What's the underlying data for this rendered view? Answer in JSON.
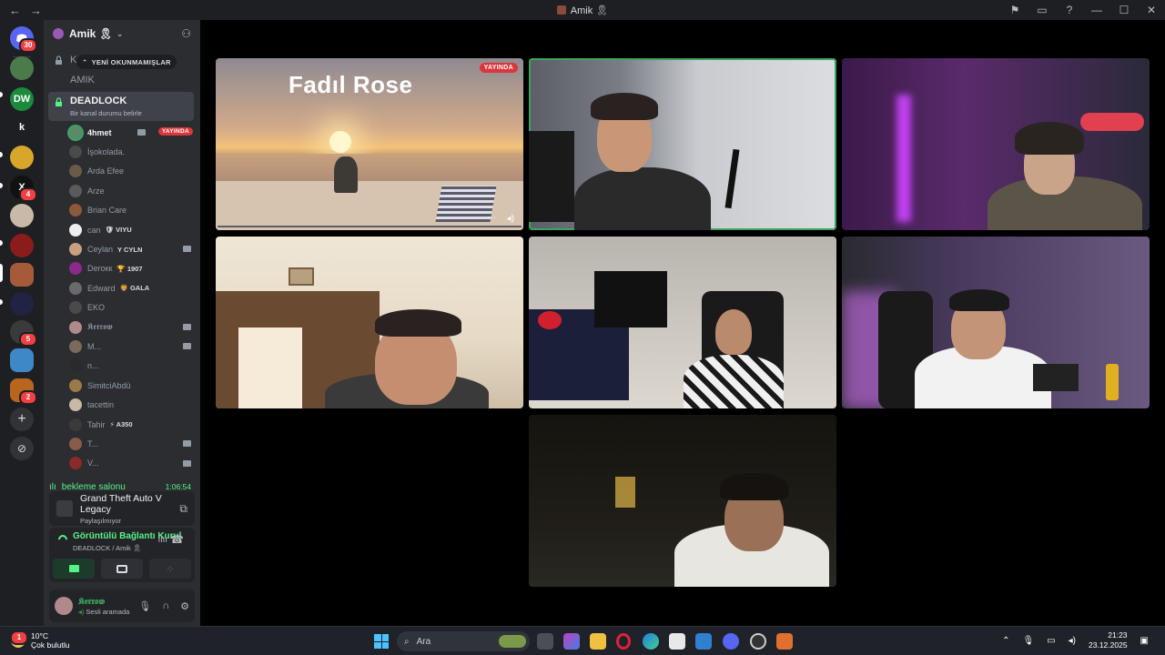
{
  "window": {
    "title": "Amik 🎗",
    "nav": {
      "back": "←",
      "forward": "→"
    },
    "controls": {
      "inbox": "⚑",
      "minimize": "—",
      "maximize": "☐",
      "close": "✕",
      "help": "?"
    }
  },
  "guilds": {
    "home_badge": "30",
    "items": [
      {
        "label": "DW",
        "color": "#1b8a3a"
      },
      {
        "label": "k",
        "color": "#1e1f22"
      },
      {
        "label": "",
        "color": "#d9a62c"
      },
      {
        "label": "X",
        "color": "#111111",
        "badge": "4"
      },
      {
        "label": "",
        "color": "#c9b9a8"
      },
      {
        "label": "",
        "color": "#8a1c1c"
      },
      {
        "label": "",
        "color": "#a55a3a"
      },
      {
        "label": "",
        "color": "#222244"
      },
      {
        "label": "",
        "color": "#3a3a3a",
        "badge": "5"
      },
      {
        "label": "",
        "color": "#3e88c8"
      },
      {
        "label": "",
        "color": "#b8651e",
        "badge": "2"
      }
    ],
    "add_icon": "+",
    "discover_icon": "⊘"
  },
  "server": {
    "name": "Amik 🎗",
    "unread_pill": "YENİ OKUNMAMIŞLAR",
    "channels_above": [
      {
        "name": "K"
      },
      {
        "name": "AMIK"
      }
    ],
    "active_channel": {
      "name": "DEADLOCK",
      "status": "Bir kanal durumu belirle"
    },
    "live_label": "YAYINDA",
    "users": [
      {
        "name": "4hmet",
        "color": "#5a8a6a",
        "me": true,
        "live": true
      },
      {
        "name": "İşokolada.",
        "color": "#4a4a4a"
      },
      {
        "name": "Arda Efee",
        "color": "#6a5a4a"
      },
      {
        "name": "Arze",
        "color": "#5a5a5a"
      },
      {
        "name": "Brian Care",
        "color": "#8a5a3a"
      },
      {
        "name": "can",
        "color": "#eeeeee",
        "tag": "🛡 VIYU"
      },
      {
        "name": "Ceylan",
        "color": "#c8a080",
        "tag": "Y CYLN",
        "cam": true
      },
      {
        "name": "Derокк",
        "color": "#8a2a8a",
        "tag": "🏆 1907"
      },
      {
        "name": "Edward",
        "color": "#6a6a6a",
        "tag": "🦁 GALA"
      },
      {
        "name": "EKO",
        "color": "#4a4a4a"
      },
      {
        "name": "𝕶𝖊𝖗𝖗𝖔𝖜",
        "color": "#b08a8a",
        "cam": true
      },
      {
        "name": "M...",
        "color": "#7a6a5a",
        "cam": true
      },
      {
        "name": "n...",
        "color": "#2a2a2a"
      },
      {
        "name": "SimitciAbdü",
        "color": "#9a7a4a"
      },
      {
        "name": "tacettin",
        "color": "#c8b8a8"
      },
      {
        "name": "Tahir",
        "color": "#3a3a3a",
        "tag": "⚡ A350"
      },
      {
        "name": "T...",
        "color": "#8a5a4a",
        "cam": true
      },
      {
        "name": "V...",
        "color": "#8a2a2a",
        "cam": true
      }
    ],
    "waiting_room": {
      "name": "bekleme salonu",
      "time": "1:06:54"
    }
  },
  "activity": {
    "game": "Grand Theft Auto V Legacy",
    "status": "Paylaşılmıyor"
  },
  "rtc": {
    "title": "Görüntülü Bağlantı Kurul",
    "subtitle": "DEADLOCK / Amik 🎗"
  },
  "user": {
    "name": "𝕶𝖊𝖗𝖗𝖔𝖜",
    "status": "Sesli aramada"
  },
  "stage": {
    "stream": {
      "title": "Fadıl Rose",
      "live": "YAYINDA"
    }
  },
  "taskbar": {
    "weather_temp": "10°C",
    "weather_desc": "Çok bulutlu",
    "weather_badge": "1",
    "search_placeholder": "Ara",
    "time": "21:23",
    "date": "23.12.2025"
  },
  "colors": {
    "accent_green": "#3ba55d",
    "live_red": "#da373c",
    "sidebar": "#2b2d31",
    "rail": "#1e1f22"
  }
}
